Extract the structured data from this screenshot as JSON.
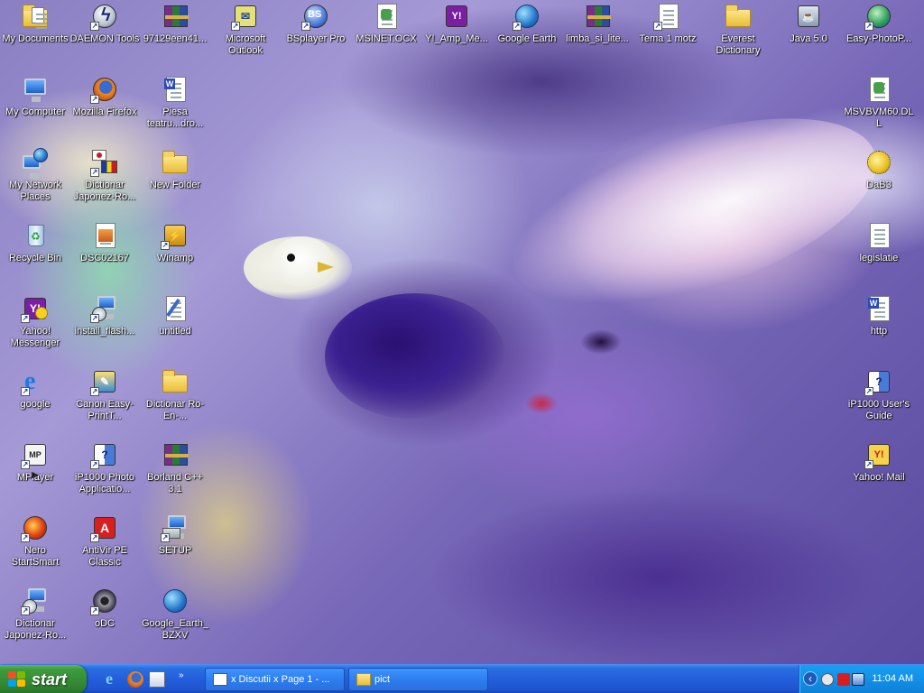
{
  "desktop": {
    "icons": [
      {
        "label": "My Documents",
        "icon": "folder-documents-icon"
      },
      {
        "label": "DAEMON Tools",
        "icon": "daemon-tools-icon"
      },
      {
        "label": "97129een41...",
        "icon": "winrar-archive-icon"
      },
      {
        "label": "Microsoft Outlook",
        "icon": "outlook-icon"
      },
      {
        "label": "BSplayer Pro",
        "icon": "bsplayer-icon"
      },
      {
        "label": "MSINET.OCX",
        "icon": "system-file-icon"
      },
      {
        "label": "Y!_Amp_Me...",
        "icon": "yahoo-amp-icon"
      },
      {
        "label": "Google Earth",
        "icon": "google-earth-icon"
      },
      {
        "label": "limba_si_lite...",
        "icon": "winrar-archive-icon"
      },
      {
        "label": "Tema 1 motz",
        "icon": "document-icon"
      },
      {
        "label": "Everest Dictionary",
        "icon": "folder-icon"
      },
      {
        "label": "Java 5.0",
        "icon": "java-icon"
      },
      {
        "label": "Easy-PhotoP...",
        "icon": "easy-photoprint-icon"
      },
      {
        "label": "My Computer",
        "icon": "my-computer-icon"
      },
      {
        "label": "Mozilla Firefox",
        "icon": "firefox-icon"
      },
      {
        "label": "Piesa teatru...dro...",
        "icon": "word-document-icon"
      },
      {
        "label": "MSVBVM60.DLL",
        "icon": "system-file-icon"
      },
      {
        "label": "My Network Places",
        "icon": "network-places-icon"
      },
      {
        "label": "Dictionar Japonez-Ro...",
        "icon": "dictionary-flags-icon"
      },
      {
        "label": "New Folder",
        "icon": "folder-icon"
      },
      {
        "label": "DaB3",
        "icon": "pufferfish-icon"
      },
      {
        "label": "Recycle Bin",
        "icon": "recycle-bin-icon"
      },
      {
        "label": "DSC02167",
        "icon": "image-file-icon"
      },
      {
        "label": "Winamp",
        "icon": "winamp-icon"
      },
      {
        "label": "legislatie",
        "icon": "text-document-icon"
      },
      {
        "label": "Yahoo! Messenger",
        "icon": "yahoo-messenger-icon"
      },
      {
        "label": "install_flash...",
        "icon": "installer-icon"
      },
      {
        "label": "untitled",
        "icon": "paint-image-icon"
      },
      {
        "label": "http",
        "icon": "word-document-icon"
      },
      {
        "label": "google",
        "icon": "internet-explorer-icon"
      },
      {
        "label": "Canon Easy-PrintT...",
        "icon": "canon-toolbox-icon"
      },
      {
        "label": "Dictionar Ro-En-...",
        "icon": "folder-icon"
      },
      {
        "label": "iP1000 User's Guide",
        "icon": "help-book-icon"
      },
      {
        "label": "MPlayer",
        "icon": "mplayer-icon"
      },
      {
        "label": "iP1000 Photo Applicatio...",
        "icon": "help-book-icon"
      },
      {
        "label": "Borland C++ 3.1",
        "icon": "winrar-archive-icon"
      },
      {
        "label": "Yahoo! Mail",
        "icon": "yahoo-mail-icon"
      },
      {
        "label": "Nero StartSmart",
        "icon": "nero-icon"
      },
      {
        "label": "AntiVir PE Classic",
        "icon": "antivir-icon"
      },
      {
        "label": "SETUP",
        "icon": "setup-icon"
      },
      {
        "label": "Dictionar Japonez-Ro...",
        "icon": "installer-icon"
      },
      {
        "label": "oDC",
        "icon": "eye-icon"
      },
      {
        "label": "Google_Earth_BZXV",
        "icon": "google-earth-icon"
      }
    ]
  },
  "taskbar": {
    "start_label": "start",
    "quicklaunch": [
      "internet-explorer-icon",
      "firefox-icon",
      "show-desktop-icon"
    ],
    "more_arrow": "»",
    "tasks": [
      {
        "label": "x Discutii x Page 1 - ...",
        "icon": "browser-window-icon"
      },
      {
        "label": "pict",
        "icon": "folder-icon"
      }
    ],
    "tray": {
      "expand_arrow": "‹",
      "icons": [
        "volume-icon",
        "antivir-tray-icon",
        "network-icon"
      ],
      "clock": "11:04 AM"
    }
  },
  "colors": {
    "taskbar_blue": "#245edb",
    "start_green": "#388e38",
    "tray_blue": "#1290e6"
  }
}
